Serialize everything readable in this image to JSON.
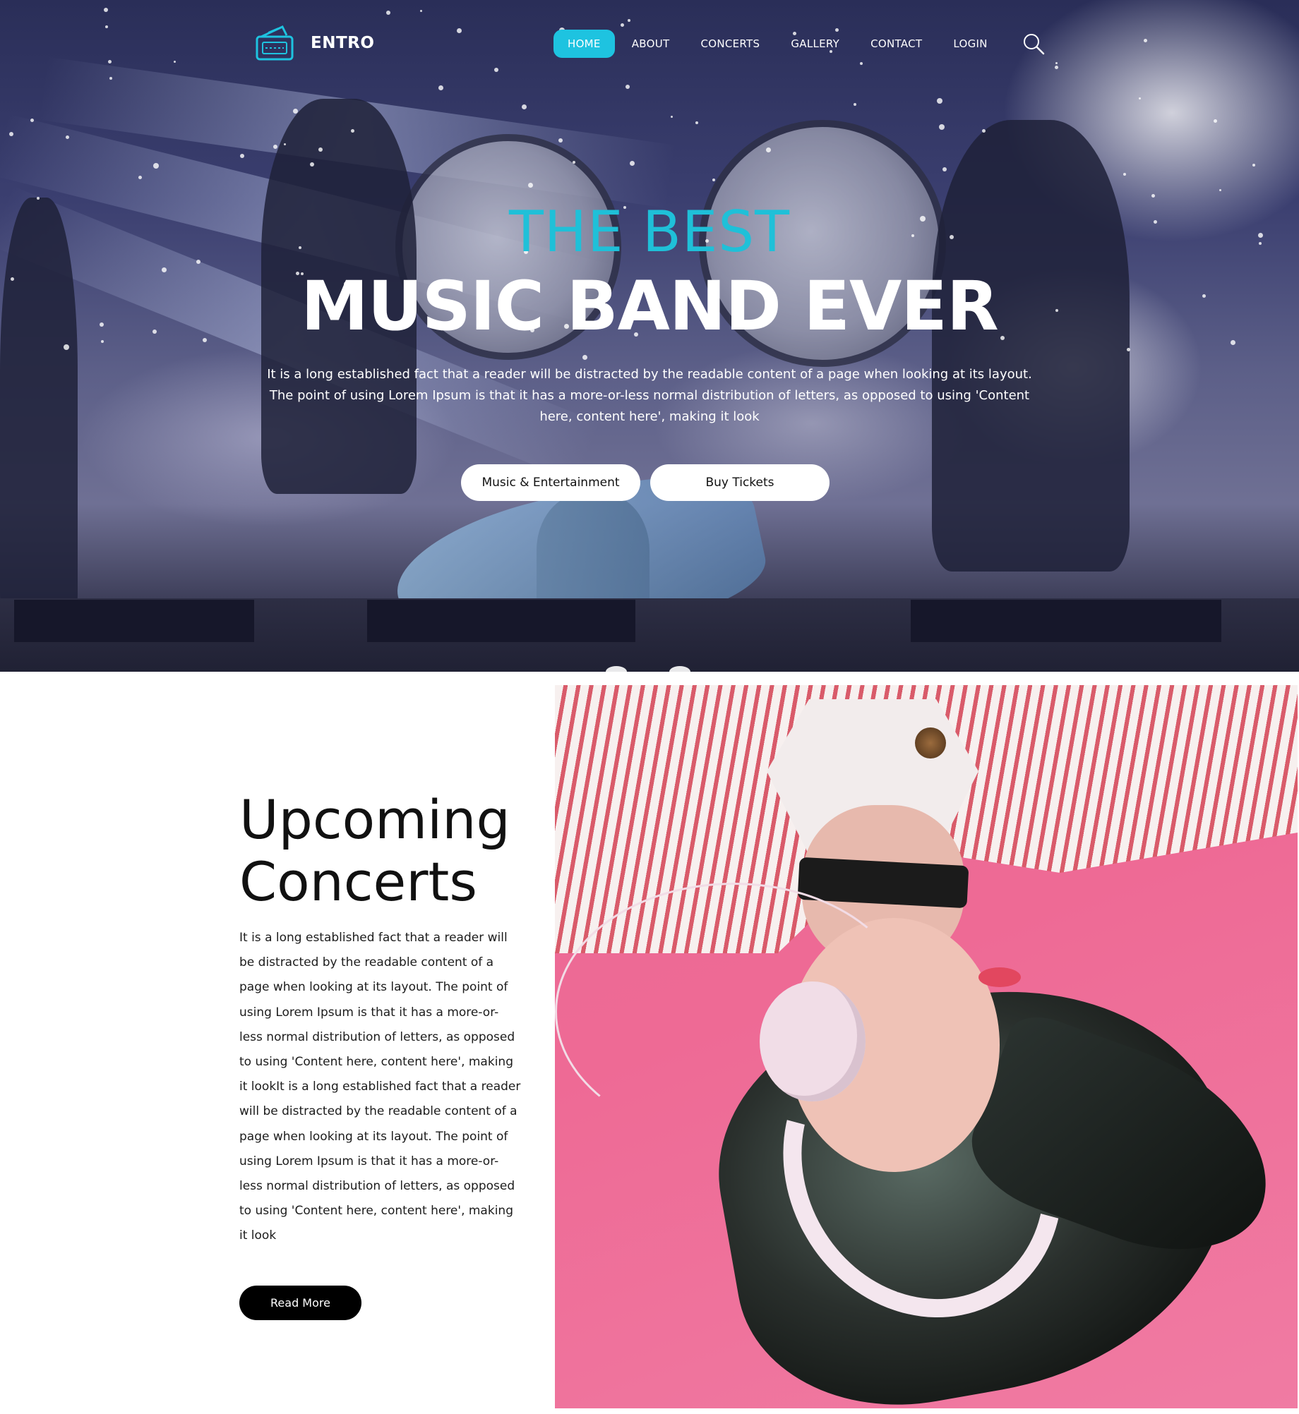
{
  "brand": {
    "name": "ENTRO",
    "logo_icon": "ticket-icon"
  },
  "nav": {
    "items": [
      "HOME",
      "ABOUT",
      "CONCERTS",
      "GALLERY",
      "CONTACT",
      "LOGIN"
    ],
    "active_index": 0,
    "search_icon": "search-icon"
  },
  "hero": {
    "subtitle": "THE BEST",
    "title": "MUSIC BAND EVER",
    "text": "It is a long established fact that a reader will be distracted by the readable content of a page when looking at its layout. The point of using Lorem Ipsum is that it has a more-or-less normal distribution of letters, as opposed to using 'Content here, content here', making it look",
    "button_primary": "Music & Entertainment",
    "button_secondary": "Buy Tickets",
    "carousel_dots": 2
  },
  "concerts": {
    "title_line1": "Upcoming",
    "title_line2": "Concerts",
    "text": "It is a long established fact that a reader will be distracted by the readable content of a page when looking at its layout. The point of using Lorem Ipsum is that it has a more-or-less normal distribution of letters, as opposed to using 'Content here, content here', making it lookIt is a long established fact that a reader will be distracted by the readable content of a page when looking at its layout. The point of using Lorem Ipsum is that it has a more-or-less normal distribution of letters, as opposed to using 'Content here, content here', making it look",
    "button": "Read More"
  },
  "colors": {
    "accent": "#1ec3e0",
    "hero_subtitle": "#1fc0d8",
    "photo_background": "#ee6a95",
    "dark_button": "#000000"
  }
}
